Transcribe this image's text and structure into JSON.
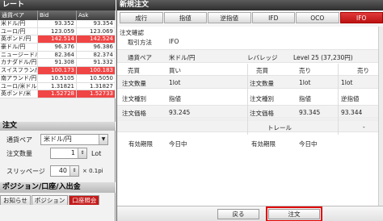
{
  "rate_panel": {
    "title": "レート",
    "columns": [
      "通貨ペア",
      "Bid",
      "Ask"
    ],
    "rows": [
      {
        "pair": "米ドル/円",
        "bid": "93.352",
        "ask": "93.354",
        "bid_up": false,
        "ask_up": false
      },
      {
        "pair": "ユーロ/円",
        "bid": "123.059",
        "ask": "123.069",
        "bid_up": false,
        "ask_up": false
      },
      {
        "pair": "英ポンド/円",
        "bid": "142.514",
        "ask": "142.524",
        "bid_up": true,
        "ask_up": true
      },
      {
        "pair": "豪ドル/円",
        "bid": "96.376",
        "ask": "96.386",
        "bid_up": false,
        "ask_up": false
      },
      {
        "pair": "ニュージードル",
        "bid": "82.364",
        "ask": "82.374",
        "bid_up": false,
        "ask_up": false
      },
      {
        "pair": "カナダドル/円",
        "bid": "91.308",
        "ask": "91.332",
        "bid_up": false,
        "ask_up": false
      },
      {
        "pair": "スイスフラン/円",
        "bid": "100.173",
        "ask": "100.183",
        "bid_up": true,
        "ask_up": true
      },
      {
        "pair": "南アランド/円",
        "bid": "10.5105",
        "ask": "10.5050",
        "bid_up": false,
        "ask_up": false
      },
      {
        "pair": "ユーロ/米ドル",
        "bid": "1.31821",
        "ask": "1.31827",
        "bid_up": false,
        "ask_up": false
      },
      {
        "pair": "英ポンド/米",
        "bid": "1.52728",
        "ask": "1.52733",
        "bid_up": true,
        "ask_up": true
      }
    ]
  },
  "order_panel": {
    "title": "注文",
    "pair_label": "通貨ペア",
    "pair_value": "米ドル/円",
    "qty_label": "注文数量",
    "qty_value": "1",
    "qty_unit": "Lot",
    "slip_label": "スリッページ",
    "slip_value": "40",
    "slip_unit": "× 0.1pi"
  },
  "position_panel": {
    "title": "ポジション/口座/入出金",
    "tabs": [
      "お知らせ",
      "ポジション",
      "口座照会"
    ]
  },
  "dialog": {
    "title": "新規注文",
    "tabs": [
      "成行",
      "指値",
      "逆指値",
      "IFD",
      "OCO",
      "IFO"
    ],
    "active_tab": "IFO",
    "confirm_heading": "注文確認",
    "trade_method_label": "取引方法",
    "trade_method_value": "IFO",
    "pair_label": "通貨ペア",
    "pair_value": "米ドル/円",
    "leverage_label": "レバレッジ",
    "leverage_value": "Level 25 (37,230円)",
    "left": {
      "side_label": "売買",
      "side_value": "買い",
      "qty_label": "注文数量",
      "qty_value": "1lot",
      "type_label": "注文種別",
      "type_value": "指値",
      "price_label": "注文価格",
      "price_value": "93.245"
    },
    "mid": {
      "side_label": "売買",
      "side_value": "売り",
      "qty_label": "注文数量",
      "qty_value": "1lot",
      "type_label": "注文種別",
      "type_value": "指値",
      "price_label": "注文価格",
      "price_value": "93.345",
      "trail_label": "トレール"
    },
    "right": {
      "side_value": "売り",
      "qty_value": "1lot",
      "type_value": "逆指値",
      "price_value": "93.344",
      "trail_value": "-"
    },
    "expiry_label": "有効期限",
    "expiry_value": "今日中",
    "expiry_label2": "有効期限",
    "expiry_value2": "今日中",
    "back_button": "戻る",
    "submit_button": "注文"
  },
  "colors": {
    "accent_red": "#c41a1a",
    "highlight": "#e00000"
  }
}
